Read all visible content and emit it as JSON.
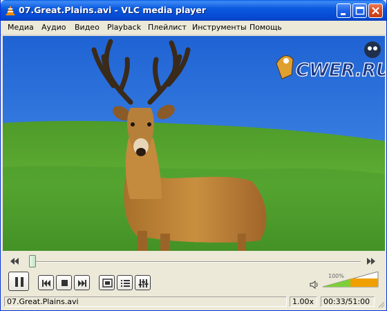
{
  "window": {
    "title": "07.Great.Plains.avi - VLC media player",
    "buttons": [
      "minimize",
      "maximize",
      "close"
    ]
  },
  "menu": [
    "Медиа",
    "Аудио",
    "Видео",
    "Playback",
    "Плейлист",
    "Инструменты",
    "Помощь"
  ],
  "video": {
    "watermark": "CWER.RU"
  },
  "seek": {
    "position_fraction": 0.01
  },
  "controls": {
    "icons": [
      "pause-icon",
      "previous-icon",
      "stop-icon",
      "next-icon",
      "fullscreen-icon",
      "playlist-icon",
      "extended-settings-icon"
    ]
  },
  "volume": {
    "percent_label": "100%",
    "level": 1.0
  },
  "status": {
    "filename": "07.Great.Plains.avi",
    "speed": "1.00x",
    "time": "00:33/51:00"
  },
  "colors": {
    "titlebar": "#0b5ade",
    "accent_orange": "#f08a00",
    "volume_green": "#7fcf3a"
  }
}
